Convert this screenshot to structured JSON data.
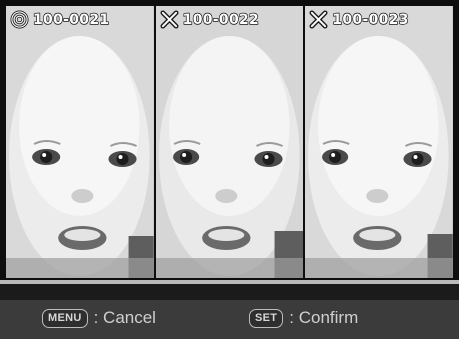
{
  "frames": [
    {
      "file_number": "100-0021",
      "status": "selected",
      "status_icon": "circle-icon"
    },
    {
      "file_number": "100-0022",
      "status": "rejected",
      "status_icon": "x-icon"
    },
    {
      "file_number": "100-0023",
      "status": "rejected",
      "status_icon": "x-icon"
    }
  ],
  "controls": {
    "menu_key": "MENU",
    "menu_action": ": Cancel",
    "set_key": "SET",
    "set_action": ": Confirm"
  }
}
